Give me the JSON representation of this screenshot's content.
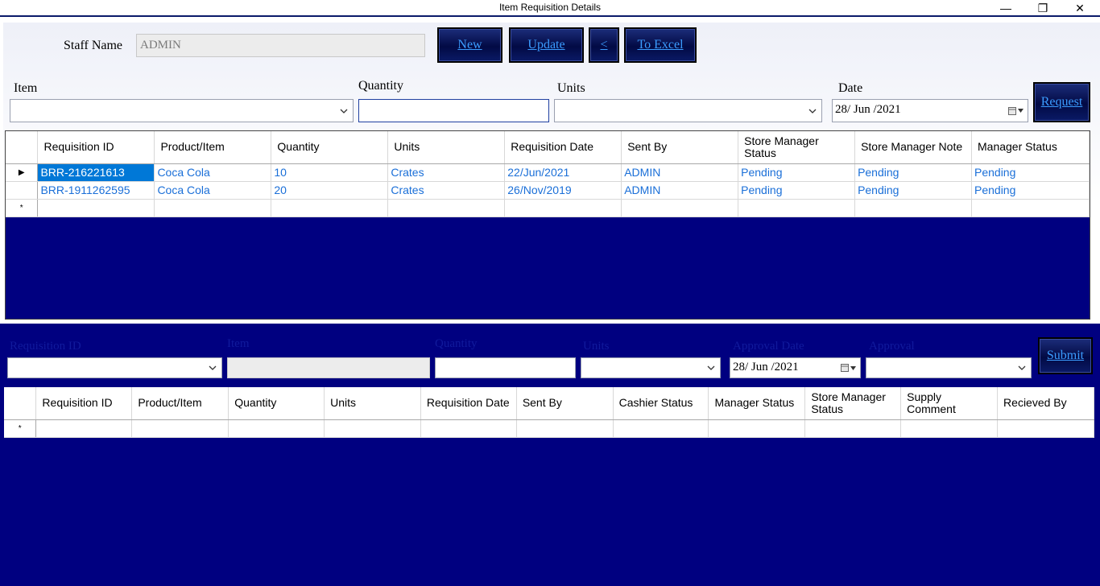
{
  "window": {
    "title": "Item Requisition Details",
    "minimize_glyph": "—",
    "maximize_glyph": "❐",
    "close_glyph": "✕"
  },
  "form": {
    "staff_name_label": "Staff Name",
    "staff_name_value": "ADMIN",
    "buttons": {
      "new": "New",
      "update": "Update",
      "back": "<",
      "to_excel": "To Excel",
      "request": "Request"
    },
    "item_label": "Item",
    "item_value": "",
    "quantity_label": "Quantity",
    "quantity_value": "",
    "units_label": "Units",
    "units_value": "",
    "date_label": "Date",
    "date_value": "28/ Jun /2021"
  },
  "requisitions_grid": {
    "columns": [
      "Requisition ID",
      "Product/Item",
      "Quantity",
      "Units",
      "Requisition Date",
      "Sent By",
      "Store Manager Status",
      "Store Manager Note",
      "Manager Status"
    ],
    "rows": [
      [
        "BRR-216221613",
        "Coca Cola",
        "10",
        "Crates",
        "22/Jun/2021",
        "ADMIN",
        "Pending",
        "Pending",
        "Pending"
      ],
      [
        "BRR-1911262595",
        "Coca Cola",
        "20",
        "Crates",
        "26/Nov/2019",
        "ADMIN",
        "Pending",
        "Pending",
        "Pending"
      ]
    ],
    "current_row_marker": "▶",
    "new_row_marker": "*"
  },
  "approval_form": {
    "requisition_id_label": "Requisition ID",
    "requisition_id_value": "",
    "item_label": "Item",
    "item_value": "",
    "quantity_label": "Quantity",
    "quantity_value": "",
    "units_label": "Units",
    "units_value": "",
    "approval_date_label": "Approval Date",
    "approval_date_value": "28/ Jun /2021",
    "approval_label": "Approval",
    "approval_value": "",
    "submit_label": "Submit"
  },
  "approvals_grid": {
    "columns": [
      "Requisition ID",
      "Product/Item",
      "Quantity",
      "Units",
      "Requisition Date",
      "Sent By",
      "Cashier Status",
      "Manager Status",
      "Store Manager Status",
      "Supply Comment",
      "Recieved By"
    ],
    "new_row_marker": "*"
  },
  "colors": {
    "panel_background": "#000080",
    "button_text": "#3b9cff",
    "grid_text": "#1a6fd8",
    "selected_cell": "#0078d7"
  }
}
